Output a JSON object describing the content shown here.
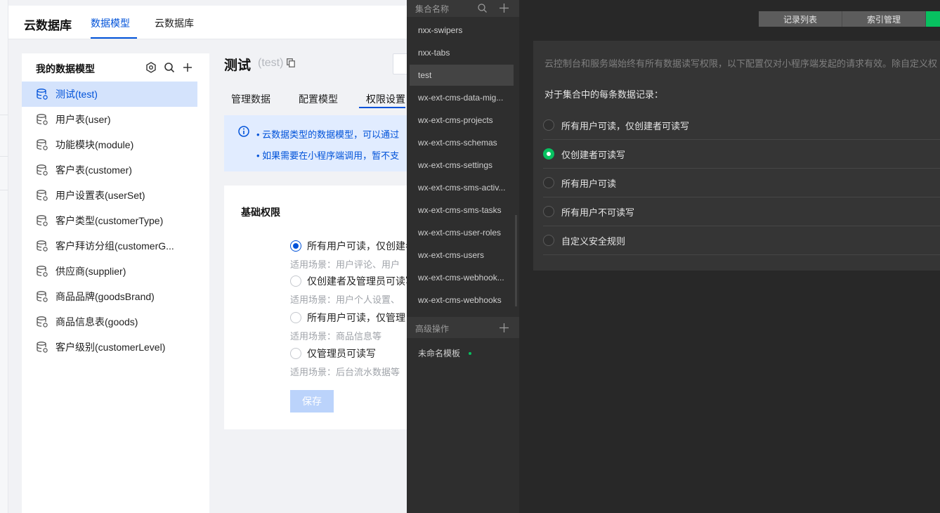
{
  "header": {
    "brand": "云数据库",
    "tabs": [
      {
        "label": "数据模型",
        "active": true
      },
      {
        "label": "云数据库",
        "active": false
      }
    ]
  },
  "models": {
    "title": "我的数据模型",
    "items": [
      {
        "label": "测试(test)",
        "active": true
      },
      {
        "label": "用户表(user)",
        "active": false
      },
      {
        "label": "功能模块(module)",
        "active": false
      },
      {
        "label": "客户表(customer)",
        "active": false
      },
      {
        "label": "用户设置表(userSet)",
        "active": false
      },
      {
        "label": "客户类型(customerType)",
        "active": false
      },
      {
        "label": "客户拜访分组(customerG...",
        "active": false
      },
      {
        "label": "供应商(supplier)",
        "active": false
      },
      {
        "label": "商品品牌(goodsBrand)",
        "active": false
      },
      {
        "label": "商品信息表(goods)",
        "active": false
      },
      {
        "label": "客户级别(customerLevel)",
        "active": false
      }
    ]
  },
  "main": {
    "title": "测试",
    "subtitle": "(test)",
    "tabs": [
      "管理数据",
      "配置模型",
      "权限设置"
    ],
    "active_tab": "权限设置",
    "info_lines": [
      "• 云数据类型的数据模型，可以通过",
      "• 如果需要在小程序端调用，暂不支"
    ],
    "perm_title": "基础权限",
    "options": [
      {
        "label": "所有用户可读，仅创建者",
        "hint": "适用场景：用户评论、用户",
        "checked": true
      },
      {
        "label": "仅创建者及管理员可读写",
        "hint": "适用场景：用户个人设置、",
        "checked": false
      },
      {
        "label": "所有用户可读，仅管理",
        "hint": "适用场景：商品信息等",
        "checked": false
      },
      {
        "label": "仅管理员可读写",
        "hint": "适用场景：后台流水数据等",
        "checked": false
      }
    ],
    "save_label": "保存"
  },
  "devtools": {
    "collection_header": "集合名称",
    "collections": [
      {
        "label": "nxx-swipers",
        "selected": false
      },
      {
        "label": "nxx-tabs",
        "selected": false
      },
      {
        "label": "test",
        "selected": true
      },
      {
        "label": "wx-ext-cms-data-mig...",
        "selected": false
      },
      {
        "label": "wx-ext-cms-projects",
        "selected": false
      },
      {
        "label": "wx-ext-cms-schemas",
        "selected": false
      },
      {
        "label": "wx-ext-cms-settings",
        "selected": false
      },
      {
        "label": "wx-ext-cms-sms-activ...",
        "selected": false
      },
      {
        "label": "wx-ext-cms-sms-tasks",
        "selected": false
      },
      {
        "label": "wx-ext-cms-user-roles",
        "selected": false
      },
      {
        "label": "wx-ext-cms-users",
        "selected": false
      },
      {
        "label": "wx-ext-cms-webhook...",
        "selected": false
      },
      {
        "label": "wx-ext-cms-webhooks",
        "selected": false
      }
    ],
    "advanced_header": "高级操作",
    "template_label": "未命名模板",
    "tabs": [
      "记录列表",
      "索引管理"
    ],
    "description": "云控制台和服务端始终有所有数据读写权限，以下配置仅对小程序端发起的请求有效。除自定义权",
    "record_heading": "对于集合中的每条数据记录：",
    "options": [
      {
        "label": "所有用户可读，仅创建者可读写",
        "checked": false
      },
      {
        "label": "仅创建者可读写",
        "checked": true
      },
      {
        "label": "所有用户可读",
        "checked": false
      },
      {
        "label": "所有用户不可读写",
        "checked": false
      },
      {
        "label": "自定义安全规则",
        "checked": false
      }
    ]
  },
  "colors": {
    "primary": "#0052d9",
    "wechat_green": "#07c160",
    "active_bg": "#d4e3fc"
  }
}
